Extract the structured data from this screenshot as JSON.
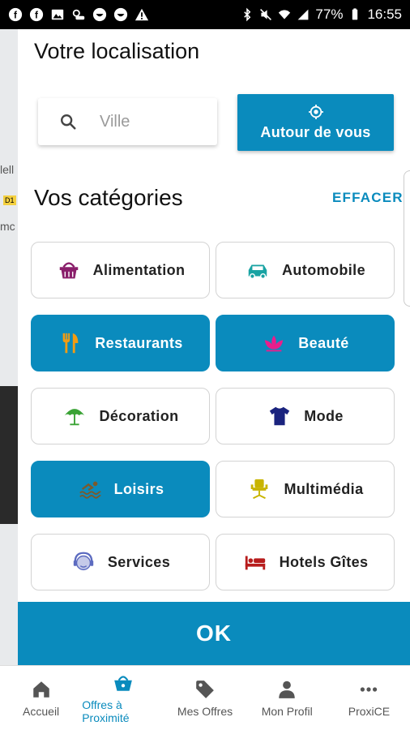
{
  "status_bar": {
    "battery": "77%",
    "time": "16:55"
  },
  "map_fragments": {
    "a": "lell",
    "b": "D1",
    "c": "mc"
  },
  "location": {
    "title": "Votre localisation",
    "search_placeholder": "Ville",
    "around_label": "Autour de vous"
  },
  "categories": {
    "title": "Vos catégories",
    "clear_label": "EFFACER",
    "items": [
      {
        "label": "Alimentation",
        "selected": false,
        "icon": "basket-icon"
      },
      {
        "label": "Automobile",
        "selected": false,
        "icon": "car-icon"
      },
      {
        "label": "Restaurants",
        "selected": true,
        "icon": "fork-knife-icon"
      },
      {
        "label": "Beauté",
        "selected": true,
        "icon": "lotus-icon"
      },
      {
        "label": "Décoration",
        "selected": false,
        "icon": "parasol-icon"
      },
      {
        "label": "Mode",
        "selected": false,
        "icon": "tshirt-icon"
      },
      {
        "label": "Loisirs",
        "selected": true,
        "icon": "swimmer-icon"
      },
      {
        "label": "Multimédia",
        "selected": false,
        "icon": "chair-icon"
      },
      {
        "label": "Services",
        "selected": false,
        "icon": "headset-icon"
      },
      {
        "label": "Hotels Gîtes",
        "selected": false,
        "icon": "bed-icon"
      }
    ]
  },
  "ok_label": "OK",
  "bottom_nav": [
    {
      "label": "Accueil",
      "icon": "home-icon",
      "active": false
    },
    {
      "label": "Offres à Proximité",
      "icon": "basket-icon",
      "active": true
    },
    {
      "label": "Mes Offres",
      "icon": "tag-icon",
      "active": false
    },
    {
      "label": "Mon Profil",
      "icon": "person-icon",
      "active": false
    },
    {
      "label": "ProxiCE",
      "icon": "more-icon",
      "active": false
    }
  ],
  "colors": {
    "accent": "#0a8bbd"
  }
}
